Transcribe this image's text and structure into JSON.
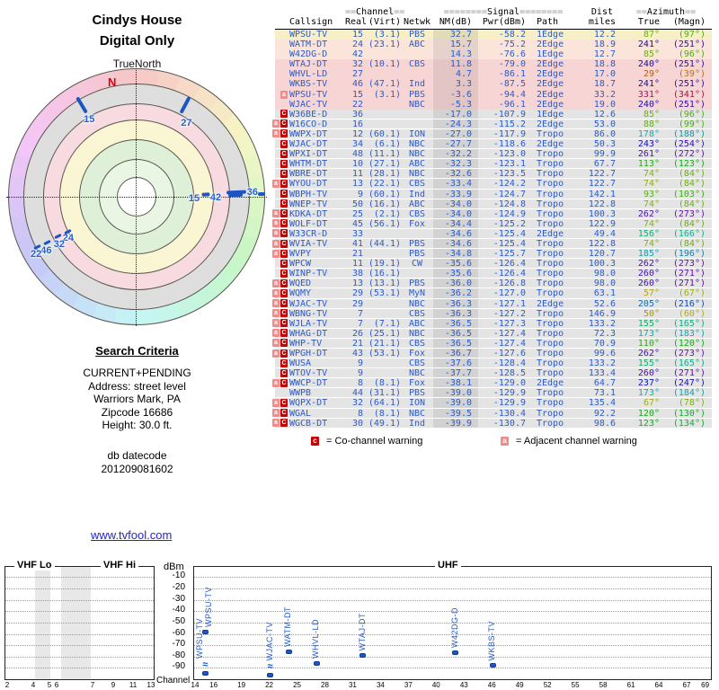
{
  "radar": {
    "title_line1": "Cindys House",
    "title_line2": "Digital Only",
    "north_ref": "TrueNorth",
    "north_letter": "N",
    "marks": [
      {
        "kind": "tick",
        "az": 329,
        "r": 119,
        "len": 20,
        "w": 4
      },
      {
        "kind": "chlabel",
        "text": "15",
        "az": 328.5,
        "r": 101
      },
      {
        "kind": "tick",
        "az": 28,
        "r": 116,
        "len": 20,
        "w": 4
      },
      {
        "kind": "chlabel",
        "text": "27",
        "az": 34,
        "r": 99
      },
      {
        "kind": "chlabel",
        "text": "15",
        "az": 91.8,
        "r": 64
      },
      {
        "kind": "tick",
        "az": 88.1,
        "r": 77,
        "len": 9,
        "w": 4
      },
      {
        "kind": "chlabel",
        "text": "42",
        "az": 90.7,
        "r": 88
      },
      {
        "kind": "tick",
        "az": 87.4,
        "r": 111,
        "len": 22,
        "w": 4
      },
      {
        "kind": "tick",
        "az": 89.2,
        "r": 110,
        "len": 16,
        "w": 4
      },
      {
        "kind": "chlabel",
        "text": "36",
        "az": 87.6,
        "r": 129
      },
      {
        "kind": "tick",
        "az": 88.8,
        "r": 139,
        "len": 8,
        "w": 4
      },
      {
        "kind": "chlabel",
        "text": "24",
        "az": 238.8,
        "r": 89
      },
      {
        "kind": "tick",
        "az": 243,
        "r": 86,
        "len": 8,
        "w": 3
      },
      {
        "kind": "chlabel",
        "text": "32",
        "az": 238.5,
        "r": 101
      },
      {
        "kind": "tick",
        "az": 243,
        "r": 98,
        "len": 8,
        "w": 3
      },
      {
        "kind": "chlabel",
        "text": "46",
        "az": 239.3,
        "r": 117
      },
      {
        "kind": "tick",
        "az": 243,
        "r": 112,
        "len": 8,
        "w": 3
      },
      {
        "kind": "chlabel",
        "text": "22",
        "az": 240.1,
        "r": 129
      },
      {
        "kind": "tick",
        "az": 243,
        "r": 124,
        "len": 8,
        "w": 3
      }
    ]
  },
  "search": {
    "title": "Search Criteria",
    "lines": [
      "CURRENT+PENDING",
      "Address: street level",
      "Warriors Mark, PA",
      "Zipcode 16686",
      "Height: 30.0 ft."
    ]
  },
  "datecode": {
    "line1": "db datecode",
    "line2": "201209081602"
  },
  "link": {
    "text": "www.tvfool.com"
  },
  "table": {
    "group_headers": {
      "channel": {
        "pre": "==",
        "word": "Channel",
        "post": "=="
      },
      "signal": {
        "pre": "========",
        "word": "Signal",
        "post": "========"
      },
      "dist": "Dist",
      "azimuth": {
        "pre": "==",
        "word": "Azimuth",
        "post": "=="
      }
    },
    "columns": [
      "Callsign",
      "Real",
      "(Virt)",
      "Netwk",
      "NM(dB)",
      "Pwr(dBm)",
      "Path",
      "miles",
      "True",
      "(Magn)"
    ],
    "rows": [
      {
        "warn": "",
        "call": "WPSU-TV",
        "real": "15",
        "virt": "(3.1)",
        "net": "PBS",
        "nm": "32.7",
        "pwr": "-58.2",
        "path": "1Edge",
        "miles": "12.2",
        "true": 87,
        "magn": 97,
        "bg": "yellow"
      },
      {
        "warn": "",
        "call": "WATM-DT",
        "real": "24",
        "virt": "(23.1)",
        "net": "ABC",
        "nm": "15.7",
        "pwr": "-75.2",
        "path": "2Edge",
        "miles": "18.9",
        "true": 241,
        "magn": 251,
        "bg": "pinkl"
      },
      {
        "warn": "",
        "call": "W42DG-D",
        "real": "42",
        "virt": "",
        "net": "",
        "nm": "14.3",
        "pwr": "-76.6",
        "path": "1Edge",
        "miles": "12.7",
        "true": 85,
        "magn": 96,
        "bg": "pinkl"
      },
      {
        "warn": "",
        "call": "WTAJ-DT",
        "real": "32",
        "virt": "(10.1)",
        "net": "CBS",
        "nm": "11.8",
        "pwr": "-79.0",
        "path": "2Edge",
        "miles": "18.8",
        "true": 240,
        "magn": 251,
        "bg": "pink"
      },
      {
        "warn": "",
        "call": "WHVL-LD",
        "real": "27",
        "virt": "",
        "net": "",
        "nm": "4.7",
        "pwr": "-86.1",
        "path": "2Edge",
        "miles": "17.0",
        "true": 29,
        "magn": 39,
        "bg": "pink"
      },
      {
        "warn": "",
        "call": "WKBS-TV",
        "real": "46",
        "virt": "(47.1)",
        "net": "Ind",
        "nm": "3.3",
        "pwr": "-87.5",
        "path": "2Edge",
        "miles": "18.7",
        "true": 241,
        "magn": 251,
        "bg": "pink"
      },
      {
        "warn": "a",
        "call": "WPSU-TV",
        "real": "15",
        "virt": "(3.1)",
        "net": "PBS",
        "nm": "-3.6",
        "pwr": "-94.4",
        "path": "2Edge",
        "miles": "33.2",
        "true": 331,
        "magn": 341,
        "bg": "pink"
      },
      {
        "warn": "",
        "call": "WJAC-TV",
        "real": "22",
        "virt": "",
        "net": "NBC",
        "nm": "-5.3",
        "pwr": "-96.1",
        "path": "2Edge",
        "miles": "19.0",
        "true": 240,
        "magn": 251,
        "bg": "pink"
      },
      {
        "warn": "c",
        "call": "W36BE-D",
        "real": "36",
        "virt": "",
        "net": "",
        "nm": "-17.0",
        "pwr": "-107.9",
        "path": "1Edge",
        "miles": "12.6",
        "true": 85,
        "magn": 96,
        "bg": "gray"
      },
      {
        "warn": "ac",
        "call": "W16CO-D",
        "real": "16",
        "virt": "",
        "net": "",
        "nm": "-24.3",
        "pwr": "-115.2",
        "path": "2Edge",
        "miles": "53.0",
        "true": 88,
        "magn": 99,
        "bg": "gray"
      },
      {
        "warn": "ac",
        "call": "WWPX-DT",
        "real": "12",
        "virt": "(60.1)",
        "net": "ION",
        "nm": "-27.0",
        "pwr": "-117.9",
        "path": "Tropo",
        "miles": "86.0",
        "true": 178,
        "magn": 188,
        "bg": "gray"
      },
      {
        "warn": "c",
        "call": "WJAC-DT",
        "real": "34",
        "virt": "(6.1)",
        "net": "NBC",
        "nm": "-27.7",
        "pwr": "-118.6",
        "path": "2Edge",
        "miles": "50.3",
        "true": 243,
        "magn": 254,
        "bg": "gray"
      },
      {
        "warn": "c",
        "call": "WPXI-DT",
        "real": "48",
        "virt": "(11.1)",
        "net": "NBC",
        "nm": "-32.2",
        "pwr": "-123.0",
        "path": "Tropo",
        "miles": "99.9",
        "true": 261,
        "magn": 272,
        "bg": "gray"
      },
      {
        "warn": "c",
        "call": "WHTM-DT",
        "real": "10",
        "virt": "(27.1)",
        "net": "ABC",
        "nm": "-32.3",
        "pwr": "-123.1",
        "path": "Tropo",
        "miles": "67.7",
        "true": 113,
        "magn": 123,
        "bg": "gray"
      },
      {
        "warn": "c",
        "call": "WBRE-DT",
        "real": "11",
        "virt": "(28.1)",
        "net": "NBC",
        "nm": "-32.6",
        "pwr": "-123.5",
        "path": "Tropo",
        "miles": "122.7",
        "true": 74,
        "magn": 84,
        "bg": "gray"
      },
      {
        "warn": "ac",
        "call": "WYOU-DT",
        "real": "13",
        "virt": "(22.1)",
        "net": "CBS",
        "nm": "-33.4",
        "pwr": "-124.2",
        "path": "Tropo",
        "miles": "122.7",
        "true": 74,
        "magn": 84,
        "bg": "gray"
      },
      {
        "warn": "c",
        "call": "WBPH-TV",
        "real": "9",
        "virt": "(60.1)",
        "net": "Ind",
        "nm": "-33.9",
        "pwr": "-124.7",
        "path": "Tropo",
        "miles": "142.1",
        "true": 93,
        "magn": 103,
        "bg": "gray"
      },
      {
        "warn": "c",
        "call": "WNEP-TV",
        "real": "50",
        "virt": "(16.1)",
        "net": "ABC",
        "nm": "-34.0",
        "pwr": "-124.8",
        "path": "Tropo",
        "miles": "122.8",
        "true": 74,
        "magn": 84,
        "bg": "gray"
      },
      {
        "warn": "ac",
        "call": "KDKA-DT",
        "real": "25",
        "virt": "(2.1)",
        "net": "CBS",
        "nm": "-34.0",
        "pwr": "-124.9",
        "path": "Tropo",
        "miles": "100.3",
        "true": 262,
        "magn": 273,
        "bg": "gray"
      },
      {
        "warn": "ac",
        "call": "WOLF-DT",
        "real": "45",
        "virt": "(56.1)",
        "net": "Fox",
        "nm": "-34.4",
        "pwr": "-125.2",
        "path": "Tropo",
        "miles": "122.9",
        "true": 74,
        "magn": 84,
        "bg": "gray"
      },
      {
        "warn": "ac",
        "call": "W33CR-D",
        "real": "33",
        "virt": "",
        "net": "",
        "nm": "-34.6",
        "pwr": "-125.4",
        "path": "2Edge",
        "miles": "49.4",
        "true": 156,
        "magn": 166,
        "bg": "gray"
      },
      {
        "warn": "ac",
        "call": "WVIA-TV",
        "real": "41",
        "virt": "(44.1)",
        "net": "PBS",
        "nm": "-34.6",
        "pwr": "-125.4",
        "path": "Tropo",
        "miles": "122.8",
        "true": 74,
        "magn": 84,
        "bg": "gray"
      },
      {
        "warn": "ac",
        "call": "WVPY",
        "real": "21",
        "virt": "",
        "net": "PBS",
        "nm": "-34.8",
        "pwr": "-125.7",
        "path": "Tropo",
        "miles": "120.7",
        "true": 185,
        "magn": 196,
        "bg": "gray"
      },
      {
        "warn": "c",
        "call": "WPCW",
        "real": "11",
        "virt": "(19.1)",
        "net": "CW",
        "nm": "-35.6",
        "pwr": "-126.4",
        "path": "Tropo",
        "miles": "100.3",
        "true": 262,
        "magn": 273,
        "bg": "gray"
      },
      {
        "warn": "c",
        "call": "WINP-TV",
        "real": "38",
        "virt": "(16.1)",
        "net": "",
        "nm": "-35.6",
        "pwr": "-126.4",
        "path": "Tropo",
        "miles": "98.0",
        "true": 260,
        "magn": 271,
        "bg": "gray"
      },
      {
        "warn": "ac",
        "call": "WQED",
        "real": "13",
        "virt": "(13.1)",
        "net": "PBS",
        "nm": "-36.0",
        "pwr": "-126.8",
        "path": "Tropo",
        "miles": "98.0",
        "true": 260,
        "magn": 271,
        "bg": "gray"
      },
      {
        "warn": "ac",
        "call": "WQMY",
        "real": "29",
        "virt": "(53.1)",
        "net": "MyN",
        "nm": "-36.2",
        "pwr": "-127.0",
        "path": "Tropo",
        "miles": "63.1",
        "true": 57,
        "magn": 67,
        "bg": "gray"
      },
      {
        "warn": "ac",
        "call": "WJAC-TV",
        "real": "29",
        "virt": "",
        "net": "NBC",
        "nm": "-36.3",
        "pwr": "-127.1",
        "path": "2Edge",
        "miles": "52.6",
        "true": 205,
        "magn": 216,
        "bg": "gray"
      },
      {
        "warn": "ac",
        "call": "WBNG-TV",
        "real": "7",
        "virt": "",
        "net": "CBS",
        "nm": "-36.3",
        "pwr": "-127.2",
        "path": "Tropo",
        "miles": "146.9",
        "true": 50,
        "magn": 60,
        "bg": "gray"
      },
      {
        "warn": "ac",
        "call": "WJLA-TV",
        "real": "7",
        "virt": "(7.1)",
        "net": "ABC",
        "nm": "-36.5",
        "pwr": "-127.3",
        "path": "Tropo",
        "miles": "133.2",
        "true": 155,
        "magn": 165,
        "bg": "gray"
      },
      {
        "warn": "ac",
        "call": "WHAG-DT",
        "real": "26",
        "virt": "(25.1)",
        "net": "NBC",
        "nm": "-36.5",
        "pwr": "-127.4",
        "path": "Tropo",
        "miles": "72.3",
        "true": 173,
        "magn": 183,
        "bg": "gray"
      },
      {
        "warn": "ac",
        "call": "WHP-TV",
        "real": "21",
        "virt": "(21.1)",
        "net": "CBS",
        "nm": "-36.5",
        "pwr": "-127.4",
        "path": "Tropo",
        "miles": "70.9",
        "true": 110,
        "magn": 120,
        "bg": "gray"
      },
      {
        "warn": "ac",
        "call": "WPGH-DT",
        "real": "43",
        "virt": "(53.1)",
        "net": "Fox",
        "nm": "-36.7",
        "pwr": "-127.6",
        "path": "Tropo",
        "miles": "99.6",
        "true": 262,
        "magn": 273,
        "bg": "gray"
      },
      {
        "warn": "c",
        "call": "WUSA",
        "real": "9",
        "virt": "",
        "net": "CBS",
        "nm": "-37.6",
        "pwr": "-128.4",
        "path": "Tropo",
        "miles": "133.2",
        "true": 155,
        "magn": 165,
        "bg": "gray"
      },
      {
        "warn": "c",
        "call": "WTOV-TV",
        "real": "9",
        "virt": "",
        "net": "NBC",
        "nm": "-37.7",
        "pwr": "-128.5",
        "path": "Tropo",
        "miles": "133.4",
        "true": 260,
        "magn": 271,
        "bg": "gray"
      },
      {
        "warn": "ac",
        "call": "WWCP-DT",
        "real": "8",
        "virt": "(8.1)",
        "net": "Fox",
        "nm": "-38.1",
        "pwr": "-129.0",
        "path": "2Edge",
        "miles": "64.7",
        "true": 237,
        "magn": 247,
        "bg": "gray"
      },
      {
        "warn": "",
        "call": "WWPB",
        "real": "44",
        "virt": "(31.1)",
        "net": "PBS",
        "nm": "-39.0",
        "pwr": "-129.9",
        "path": "Tropo",
        "miles": "73.1",
        "true": 173,
        "magn": 184,
        "bg": "gray"
      },
      {
        "warn": "ac",
        "call": "WQPX-DT",
        "real": "32",
        "virt": "(64.1)",
        "net": "ION",
        "nm": "-39.0",
        "pwr": "-129.9",
        "path": "Tropo",
        "miles": "135.4",
        "true": 67,
        "magn": 78,
        "bg": "gray"
      },
      {
        "warn": "ac",
        "call": "WGAL",
        "real": "8",
        "virt": "(8.1)",
        "net": "NBC",
        "nm": "-39.5",
        "pwr": "-130.4",
        "path": "Tropo",
        "miles": "92.2",
        "true": 120,
        "magn": 130,
        "bg": "gray"
      },
      {
        "warn": "ac",
        "call": "WGCB-DT",
        "real": "30",
        "virt": "(49.1)",
        "net": "Ind",
        "nm": "-39.9",
        "pwr": "-130.7",
        "path": "Tropo",
        "miles": "98.6",
        "true": 123,
        "magn": 134,
        "bg": "gray"
      }
    ],
    "legend": {
      "co_symbol": "c",
      "co_text": "= Co-channel warning",
      "adj_symbol": "a",
      "adj_text": "= Adjacent channel warning"
    }
  },
  "chart_data": {
    "type": "scatter",
    "ylabel": "dBm",
    "xlabel": "Channel",
    "band_labels": {
      "vhf_lo": "VHF Lo",
      "vhf_hi": "VHF Hi",
      "uhf": "UHF"
    },
    "y_ticks": [
      -10,
      -20,
      -30,
      -40,
      -50,
      -60,
      -70,
      -80,
      -90
    ],
    "vhf_axis_channels": [
      2,
      4,
      5,
      6,
      7,
      9,
      11,
      13
    ],
    "uhf_axis_channels": [
      14,
      16,
      19,
      22,
      25,
      28,
      31,
      34,
      37,
      40,
      43,
      46,
      49,
      52,
      55,
      58,
      61,
      64,
      67,
      69
    ],
    "stations": [
      {
        "callsign": "WPSU-TV",
        "channel": 15,
        "dbm": -58.2,
        "offscale": false
      },
      {
        "callsign": "WPSU-TV",
        "channel": 15,
        "dbm": -94.4,
        "offscale": true
      },
      {
        "callsign": "WJAC-TV",
        "channel": 22,
        "dbm": -96.1,
        "offscale": true
      },
      {
        "callsign": "WATM-DT",
        "channel": 24,
        "dbm": -75.2,
        "offscale": false
      },
      {
        "callsign": "WHVL-LD",
        "channel": 27,
        "dbm": -86.1,
        "offscale": false
      },
      {
        "callsign": "WTAJ-DT",
        "channel": 32,
        "dbm": -79.0,
        "offscale": false
      },
      {
        "callsign": "W42DG-D",
        "channel": 42,
        "dbm": -76.6,
        "offscale": false
      },
      {
        "callsign": "WKBS-TV",
        "channel": 46,
        "dbm": -87.5,
        "offscale": false
      }
    ]
  },
  "colors": {
    "table_blue": "#2b5bc9",
    "bar_blue": "#1d57c6",
    "warn_co": "#c40000",
    "warn_adj": "#f08c8c",
    "north_red": "#e00000",
    "link_blue": "#2525cf"
  }
}
